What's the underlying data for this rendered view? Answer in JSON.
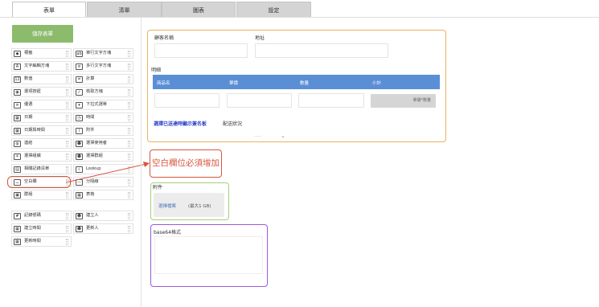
{
  "tabs": [
    {
      "label": "表單",
      "active": true
    },
    {
      "label": "清單",
      "active": false
    },
    {
      "label": "圖表",
      "active": false
    },
    {
      "label": "設定",
      "active": false
    }
  ],
  "save_button": "儲存表單",
  "palette_left": [
    {
      "label": "標籤",
      "icon": "tag-icon",
      "glyph": "◆"
    },
    {
      "label": "文字編輯方塊",
      "icon": "text-edit-icon",
      "glyph": "A"
    },
    {
      "label": "數值",
      "icon": "number-icon",
      "glyph": "12"
    },
    {
      "label": "選項按鈕",
      "icon": "radio-icon",
      "glyph": "◉"
    },
    {
      "label": "優選",
      "icon": "list-icon",
      "glyph": "≡"
    },
    {
      "label": "日期",
      "icon": "calendar-icon",
      "glyph": "▦"
    },
    {
      "label": "日期與時間",
      "icon": "datetime-icon",
      "glyph": "▦"
    },
    {
      "label": "連結",
      "icon": "globe-icon",
      "glyph": "◍"
    },
    {
      "label": "選擇組織",
      "icon": "org-icon",
      "glyph": "⚘"
    },
    {
      "label": "相關記錄清單",
      "icon": "related-records-icon",
      "glyph": "▤"
    },
    {
      "label": "空白欄",
      "icon": "blank-space-icon",
      "glyph": "⌴"
    },
    {
      "label": "群組",
      "icon": "group-icon",
      "glyph": "▣"
    },
    {
      "label": "記錄號碼",
      "icon": "record-number-icon",
      "glyph": "#"
    },
    {
      "label": "建立時間",
      "icon": "created-time-icon",
      "glyph": "▦"
    },
    {
      "label": "更新時間",
      "icon": "updated-time-icon",
      "glyph": "▦"
    }
  ],
  "palette_right": [
    {
      "label": "單行文字方塊",
      "icon": "single-line-text-icon",
      "glyph": "ab"
    },
    {
      "label": "多行文字方塊",
      "icon": "multi-line-text-icon",
      "glyph": "≡"
    },
    {
      "label": "計算",
      "icon": "calculator-icon",
      "glyph": "="
    },
    {
      "label": "核取方塊",
      "icon": "checkbox-icon",
      "glyph": "✓"
    },
    {
      "label": "下拉式選單",
      "icon": "dropdown-icon",
      "glyph": "▾"
    },
    {
      "label": "時間",
      "icon": "clock-icon",
      "glyph": "◷"
    },
    {
      "label": "附件",
      "icon": "paperclip-icon",
      "glyph": "⌇"
    },
    {
      "label": "選擇使用者",
      "icon": "user-icon",
      "glyph": "☻"
    },
    {
      "label": "選擇群組",
      "icon": "users-icon",
      "glyph": "☻"
    },
    {
      "label": "Lookup",
      "icon": "lookup-icon",
      "glyph": "⌕"
    },
    {
      "label": "分隔線",
      "icon": "divider-icon",
      "glyph": "—"
    },
    {
      "label": "表格",
      "icon": "table-icon",
      "glyph": "▦"
    },
    {
      "label": "建立人",
      "icon": "creator-icon",
      "glyph": "☻"
    },
    {
      "label": "更新人",
      "icon": "updater-icon",
      "glyph": "☻"
    }
  ],
  "form": {
    "customer_label": "顧客名稱",
    "address_label": "地址",
    "detail_label": "明細",
    "table_headers": [
      "商品名",
      "單價",
      "數量",
      "小計"
    ],
    "subtotal_placeholder": "單價*數量",
    "show_signature_link": "選擇已送達時顯示簽名板",
    "delivery_label": "配送狀況",
    "delivery_value": "-----",
    "annotation_text": "空白欄位必須增加",
    "attachment_label": "附件",
    "file_select": "選擇檔案",
    "file_limit": "(最大1 GB)",
    "base64_label": "base64格式"
  }
}
